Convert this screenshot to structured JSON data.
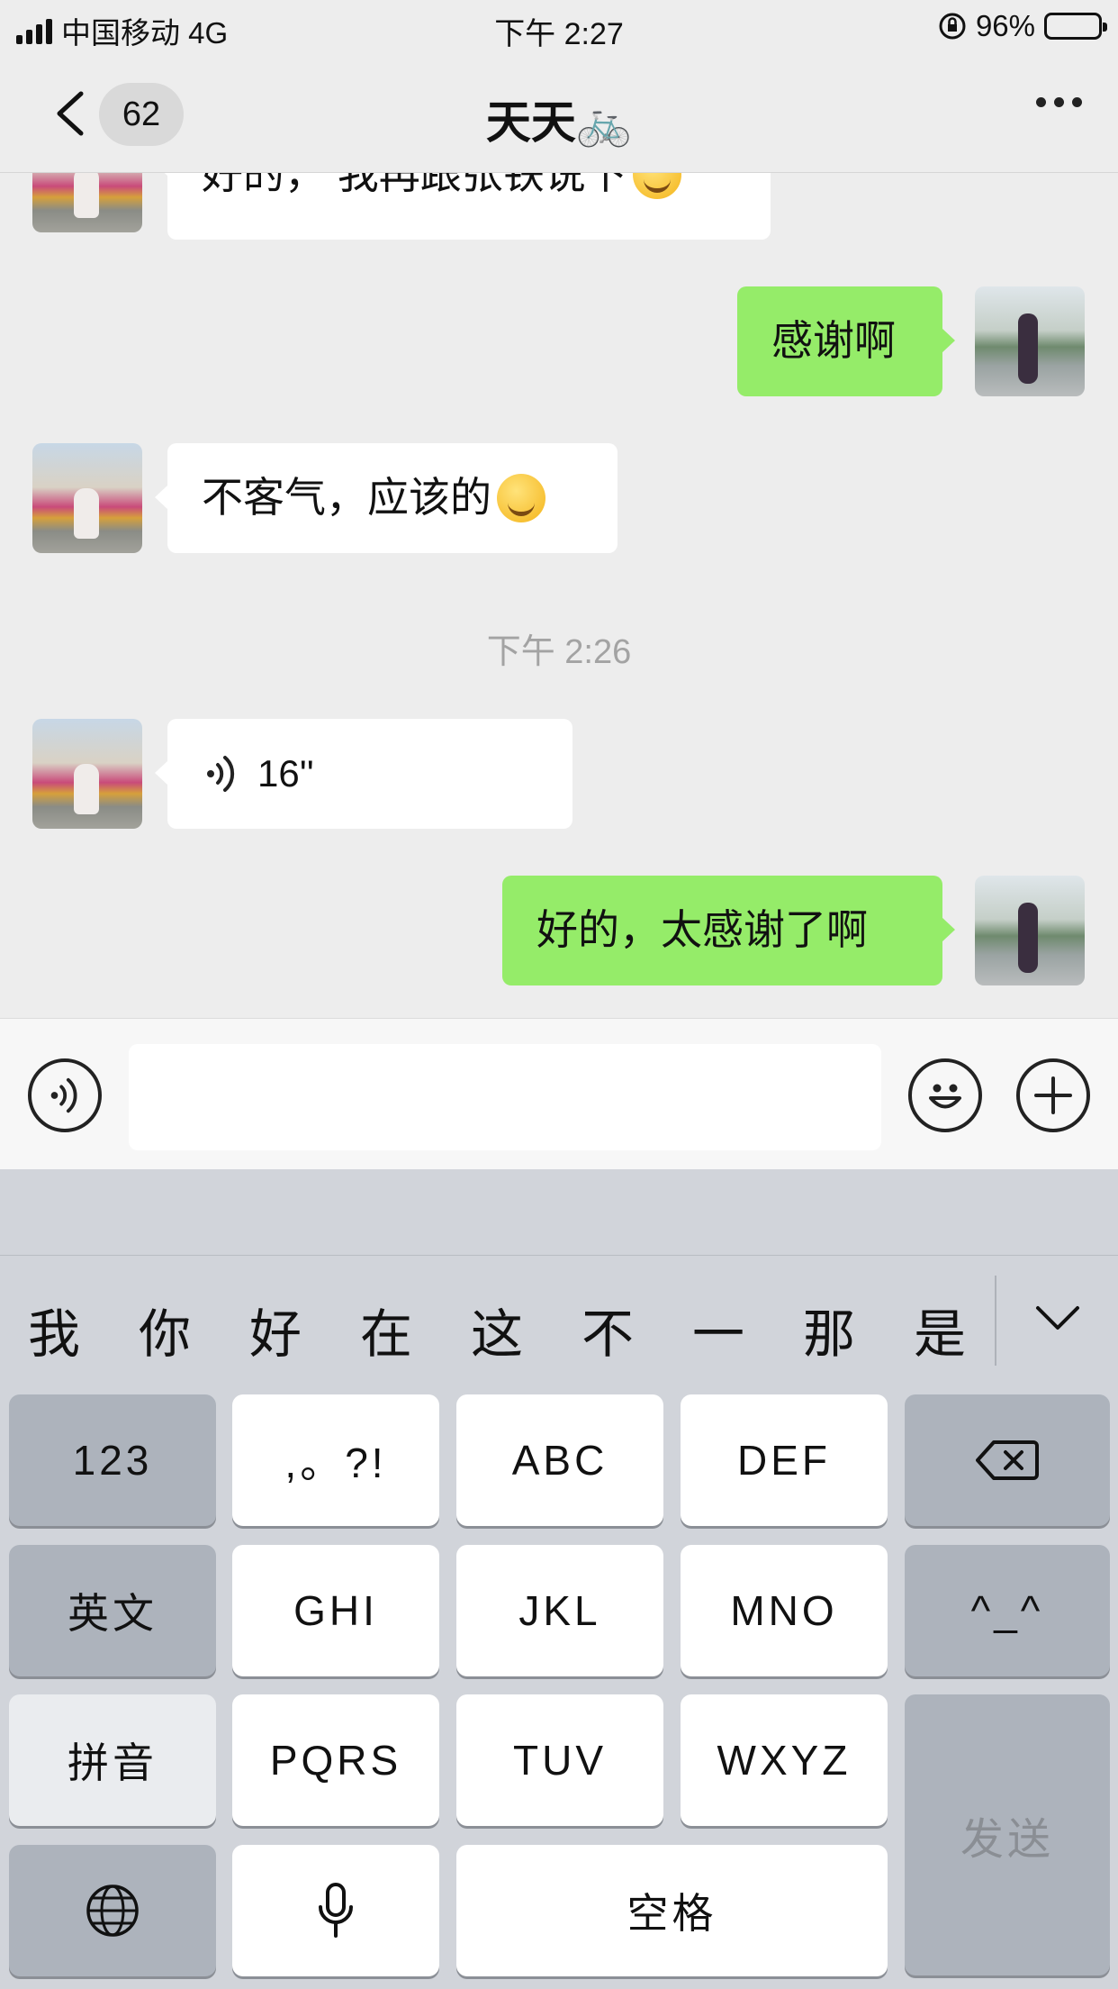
{
  "status_bar": {
    "carrier": "中国移动 4G",
    "time": "下午 2:27",
    "battery": "96%",
    "battery_level": 0.96
  },
  "header": {
    "back_count": "62",
    "title": "天天🚲"
  },
  "messages": [
    {
      "dir": "in",
      "text": "好的， 我再跟张铁说下",
      "emoji": "smiling-face-icon"
    },
    {
      "dir": "out",
      "text": "感谢啊"
    },
    {
      "dir": "in",
      "text": "不客气，应该的",
      "emoji": "grinning-face-icon"
    },
    {
      "timestamp": "下午 2:26"
    },
    {
      "dir": "in",
      "voice_duration": "16''"
    },
    {
      "dir": "out",
      "text": "好的，太感谢了啊"
    }
  ],
  "input": {
    "value": "",
    "placeholder": ""
  },
  "keyboard": {
    "candidates": [
      "我",
      "你",
      "好",
      "在",
      "这",
      "不",
      "一",
      "那",
      "是"
    ],
    "row1": [
      "123",
      ",。?!",
      "ABC",
      "DEF"
    ],
    "row2": [
      "英文",
      "GHI",
      "JKL",
      "MNO",
      "^_^"
    ],
    "row3": [
      "拼音",
      "PQRS",
      "TUV",
      "WXYZ"
    ],
    "send": "发送",
    "space": "空格"
  }
}
